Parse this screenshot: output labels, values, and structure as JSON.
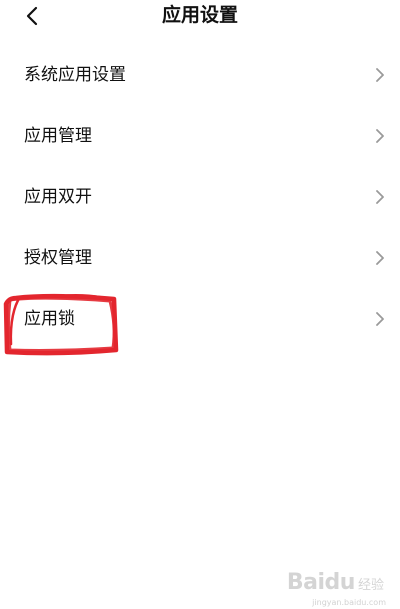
{
  "header": {
    "title": "应用设置",
    "back_icon": "chevron-left-icon"
  },
  "settings": {
    "items": [
      {
        "label": "系统应用设置",
        "icon": "chevron-right-icon"
      },
      {
        "label": "应用管理",
        "icon": "chevron-right-icon"
      },
      {
        "label": "应用双开",
        "icon": "chevron-right-icon"
      },
      {
        "label": "授权管理",
        "icon": "chevron-right-icon"
      },
      {
        "label": "应用锁",
        "icon": "chevron-right-icon"
      }
    ]
  },
  "annotation": {
    "color": "#e3262e",
    "target": "应用锁"
  },
  "watermark": {
    "brand": "Baidu",
    "suffix": "经验",
    "url": "jingyan.baidu.com"
  },
  "colors": {
    "text": "#111111",
    "chevron": "#9a9a9a",
    "background": "#ffffff"
  }
}
